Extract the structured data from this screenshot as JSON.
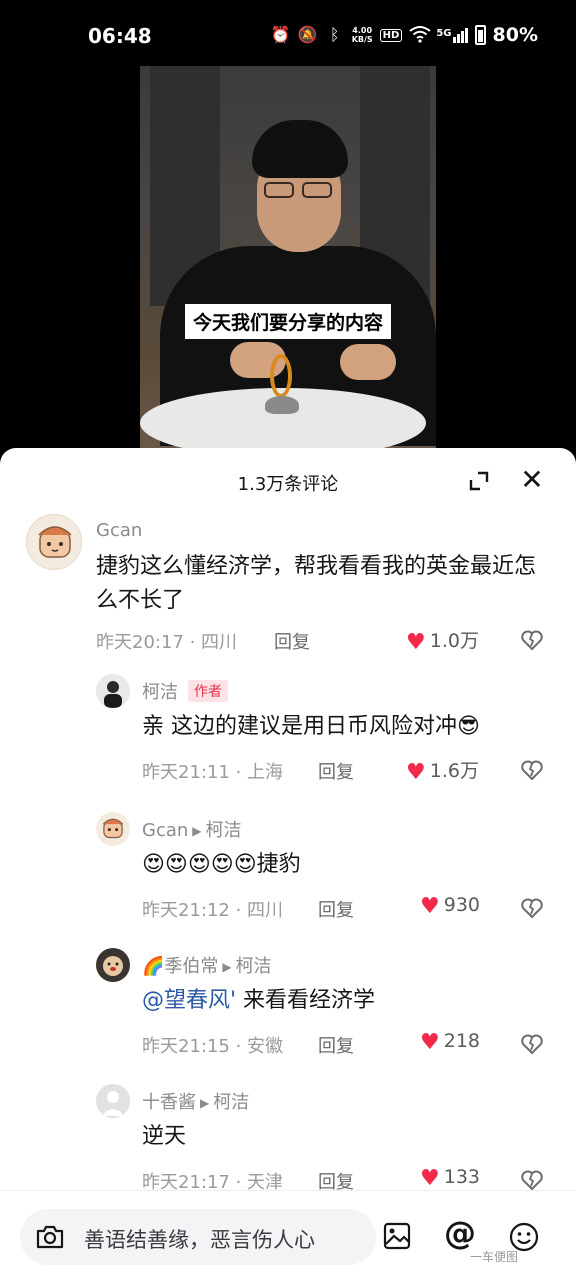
{
  "status_bar": {
    "time": "06:48",
    "net_speed_top": "4.00",
    "net_speed_bottom": "KB/S",
    "hd": "HD",
    "signal": "5G",
    "battery": "80%"
  },
  "video": {
    "subtitle": "今天我们要分享的内容"
  },
  "panel": {
    "title": "1.3万条评论"
  },
  "comments": [
    {
      "user": "Gcan",
      "text": "捷豹这么懂经济学，帮我看看我的英金最近怎么不长了",
      "meta": "昨天20:17 · 四川",
      "reply": "回复",
      "likes": "1.0万"
    },
    {
      "user": "柯洁",
      "badge": "作者",
      "text": "亲 这边的建议是用日币风险对冲😎",
      "meta": "昨天21:11 · 上海",
      "reply": "回复",
      "likes": "1.6万"
    },
    {
      "user": "Gcan",
      "reply_to": "柯洁",
      "text": "😍😍😍😍😍捷豹",
      "meta": "昨天21:12 · 四川",
      "reply": "回复",
      "likes": "930"
    },
    {
      "user": "🌈季伯常",
      "reply_to": "柯洁",
      "mention": "@望春风'",
      "text": " 来看看经济学",
      "meta": "昨天21:15 · 安徽",
      "reply": "回复",
      "likes": "218"
    },
    {
      "user": "十香酱",
      "reply_to": "柯洁",
      "text": "逆天",
      "meta": "昨天21:17 · 天津",
      "reply": "回复",
      "likes": "133"
    }
  ],
  "input_bar": {
    "placeholder": "善语结善缘，恶言伤人心"
  },
  "watermark": "一车便图",
  "colors": {
    "like_heart": "#f2294a",
    "author_badge_bg": "#fde2e6",
    "author_badge_text": "#e7324c",
    "mention": "#2d5aa6"
  }
}
